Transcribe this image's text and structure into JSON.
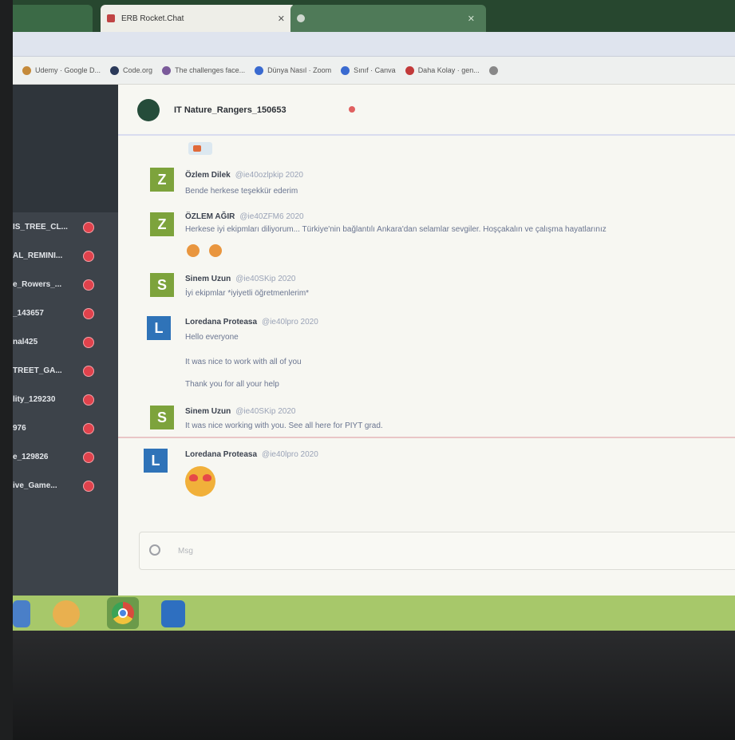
{
  "tabs": [
    {
      "label": ""
    },
    {
      "label": "ERB Rocket.Chat"
    },
    {
      "label": ""
    }
  ],
  "address_url": "",
  "bookmarks": [
    {
      "label": "Udemy · Google D...",
      "color": "#c58a3a"
    },
    {
      "label": "Code.org",
      "color": "#2b3a5a"
    },
    {
      "label": "The challenges face...",
      "color": "#7a5a9a"
    },
    {
      "label": "Dünya Nasıl · Zoom",
      "color": "#3a6ad0"
    },
    {
      "label": "Sınıf · Canva",
      "color": "#3a6ad0"
    },
    {
      "label": "Daha Kolay · gen...",
      "color": "#c23a3a"
    },
    {
      "label": "",
      "color": "#888888"
    }
  ],
  "sidebar": {
    "faint_heading": "",
    "rooms": [
      {
        "label": "IS_TREE_CL..."
      },
      {
        "label": "AL_REMINI..."
      },
      {
        "label": "e_Rowers_..."
      },
      {
        "label": "_143657"
      },
      {
        "label": "nal425"
      },
      {
        "label": "TREET_GA..."
      },
      {
        "label": "lity_129230"
      },
      {
        "label": "976"
      },
      {
        "label": "e_129826"
      },
      {
        "label": "ive_Game..."
      }
    ]
  },
  "room": {
    "title": "IT Nature_Rangers_150653",
    "star_color": "#e06060"
  },
  "messages": [
    {
      "initial": "Z",
      "name": "Özlem Dilek",
      "handle": "@ie40ozlpkip 2020",
      "text": "Bende herkese teşekkür ederim",
      "color": "#7da33c"
    },
    {
      "initial": "Z",
      "name": "ÖZLEM AĞIR",
      "handle": "@ie40ZFM6 2020",
      "text": "Herkese iyi ekipmları diliyorum... Türkiye'nin bağlantılı Ankara'dan selamlar sevgiler. Hoşçakalın ve çalışma hayatlarınız",
      "color": "#7da33c"
    },
    {
      "initial": "S",
      "name": "Sinem Uzun",
      "handle": "@ie40SKip 2020",
      "text": "İyi ekipmlar *iyiyetli öğretmenlerim*",
      "color": "#7da33c"
    },
    {
      "initial": "L",
      "name": "Loredana Proteasa",
      "handle": "@ie40lpro 2020",
      "text": "Hello everyone",
      "text2": "It was nice to work with all of you",
      "text3": "Thank you for all your help",
      "color": "#2f73b8"
    },
    {
      "initial": "S",
      "name": "Sinem Uzun",
      "handle": "@ie40SKip 2020",
      "text": "It was nice working with you. See all here for PIYT grad.",
      "color": "#7da33c"
    },
    {
      "initial": "L",
      "name": "Loredana Proteasa",
      "handle": "@ie40lpro 2020",
      "text": "",
      "color": "#2f73b8"
    }
  ],
  "composer": {
    "placeholder": "Msg"
  },
  "taskbar": {
    "apps": [
      "windows-explorer",
      "media-player",
      "chrome",
      "word"
    ]
  }
}
